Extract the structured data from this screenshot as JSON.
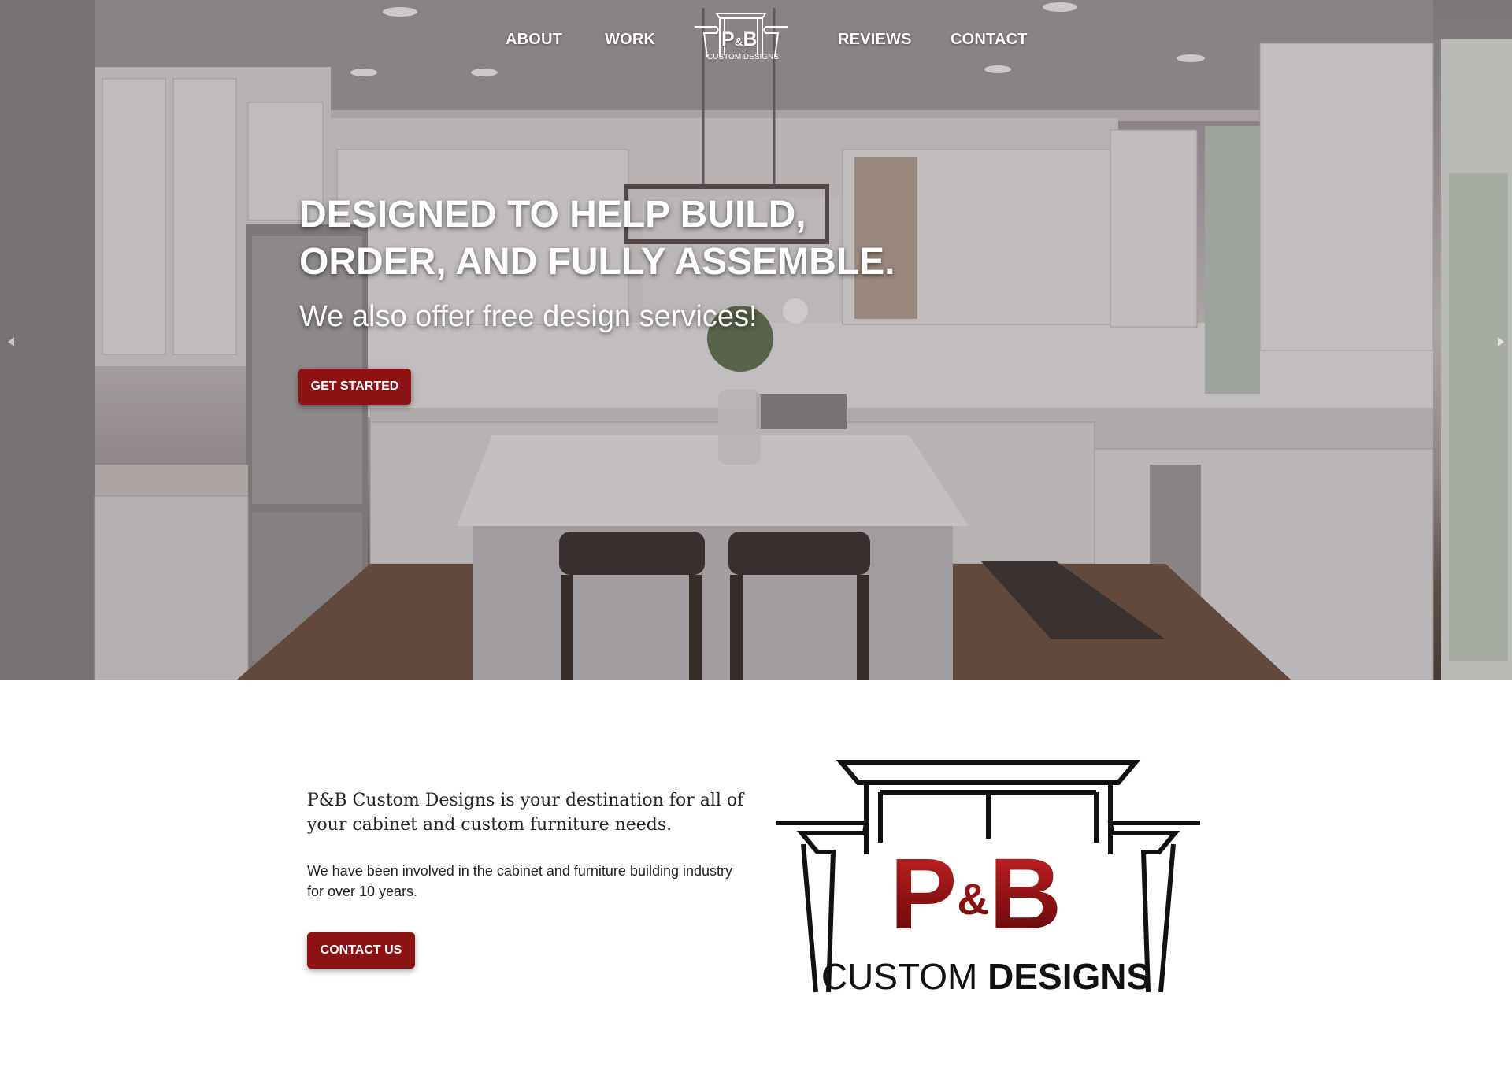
{
  "nav": {
    "items": [
      {
        "label": "ABOUT"
      },
      {
        "label": "WORK"
      },
      {
        "label": "REVIEWS"
      },
      {
        "label": "CONTACT"
      }
    ],
    "logo": {
      "monogram_left": "P",
      "monogram_amp": "&",
      "monogram_right": "B",
      "subtitle": "CUSTOM DESIGNS"
    }
  },
  "hero": {
    "heading_line1": "DESIGNED TO HELP BUILD,",
    "heading_line2": "ORDER, AND FULLY ASSEMBLE.",
    "subheading": "We also offer free design services!",
    "cta_label": "GET STARTED"
  },
  "about": {
    "heading": "P&B Custom Designs is your destination for all of your cabinet and custom furniture needs.",
    "body": "We have been involved in the cabinet and furniture building industry for over 10 years.",
    "cta_label": "CONTACT US",
    "logo": {
      "monogram_left": "P",
      "monogram_amp": "&",
      "monogram_right": "B",
      "subtitle_light": "CUSTOM ",
      "subtitle_bold": "DESIGNS"
    }
  },
  "icons": {
    "prev": "chevron-left-icon",
    "next": "chevron-right-icon"
  },
  "colors": {
    "accent": "#8d1313",
    "logo_red": "#a01a1a",
    "text_dark": "#222222"
  }
}
